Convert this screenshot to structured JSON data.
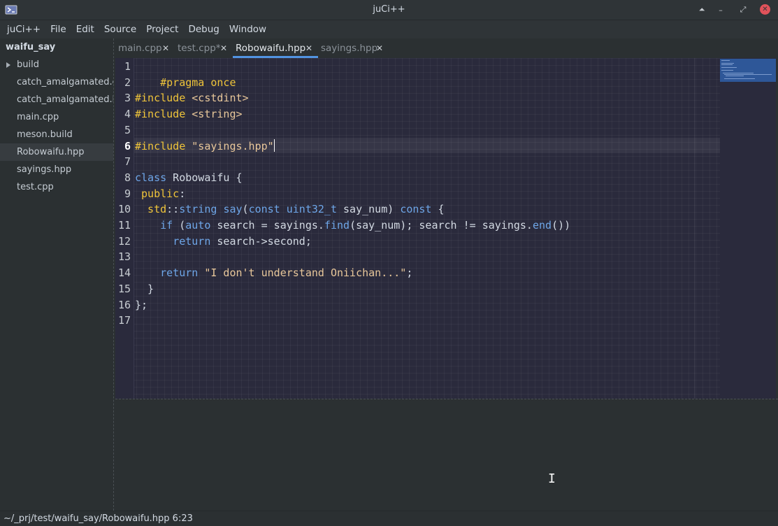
{
  "window": {
    "title": "juCi++",
    "controls": {
      "shade_icon": "⏶",
      "minimize_icon": "–",
      "maximize_icon": "⤢",
      "close_icon": "✕"
    }
  },
  "menu": [
    "juCi++",
    "File",
    "Edit",
    "Source",
    "Project",
    "Debug",
    "Window"
  ],
  "sidebar": {
    "project": "waifu_say",
    "items": [
      {
        "label": "build",
        "type": "folder"
      },
      {
        "label": "catch_amalgamated.cpp",
        "type": "file"
      },
      {
        "label": "catch_amalgamated.hpp",
        "type": "file"
      },
      {
        "label": "main.cpp",
        "type": "file"
      },
      {
        "label": "meson.build",
        "type": "file"
      },
      {
        "label": "Robowaifu.hpp",
        "type": "file",
        "selected": true
      },
      {
        "label": "sayings.hpp",
        "type": "file"
      },
      {
        "label": "test.cpp",
        "type": "file"
      }
    ]
  },
  "tabs": [
    {
      "label": "main.cpp",
      "close": "✕"
    },
    {
      "label": "test.cpp*",
      "close": "✕"
    },
    {
      "label": "Robowaifu.hpp",
      "close": "✕",
      "active": true
    },
    {
      "label": "sayings.hpp",
      "close": "✕"
    }
  ],
  "editor": {
    "line_numbers": [
      "1",
      "2",
      "3",
      "4",
      "5",
      "6",
      "7",
      "8",
      "9",
      "10",
      "11",
      "12",
      "13",
      "14",
      "15",
      "16",
      "17"
    ],
    "current_line": "6",
    "code": {
      "l1": {
        "a": "#pragma once"
      },
      "l3": {
        "a": "#include ",
        "b": "<cstdint>"
      },
      "l4": {
        "a": "#include ",
        "b": "<string>"
      },
      "l6": {
        "a": "#include ",
        "b": "\"sayings.hpp\""
      },
      "l8": {
        "a": "class",
        "b": " Robowaifu {"
      },
      "l9": {
        "a": " public",
        "b": ":"
      },
      "l10": {
        "a": "  std",
        "b": "::",
        "c": "string",
        "d": " ",
        "e": "say",
        "f": "(",
        "g": "const",
        "h": " ",
        "i": "uint32_t",
        "j": " say_num) ",
        "k": "const",
        "l": " {"
      },
      "l11": {
        "a": "    ",
        "b": "if",
        "c": " (",
        "d": "auto",
        "e": " search = sayings.",
        "f": "find",
        "g": "(say_num); search != sayings.",
        "h": "end",
        "i": "())"
      },
      "l12": {
        "a": "      ",
        "b": "return",
        "c": " search->second;"
      },
      "l14": {
        "a": "    ",
        "b": "return",
        "c": " ",
        "d": "\"I don't understand Oniichan...\"",
        "e": ";"
      },
      "l15": {
        "a": "  }"
      },
      "l16": {
        "a": "};"
      }
    }
  },
  "status": {
    "path": "~/_prj/test/waifu_say/Robowaifu.hpp 6:23"
  },
  "pointer": {
    "glyph": "I"
  },
  "colors": {
    "editor_bg": "#2a2a3c",
    "preprocessor": "#f0c53a",
    "keyword": "#6ea6e8",
    "string": "#e8c79a",
    "accent": "#5294e2",
    "close_button": "#e0525a"
  }
}
